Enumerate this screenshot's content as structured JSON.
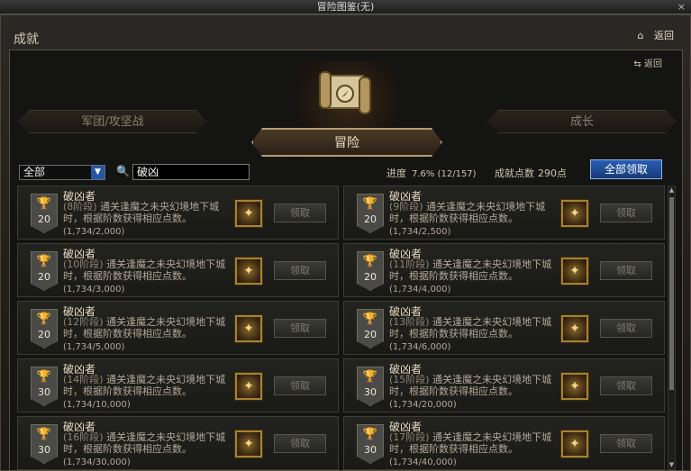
{
  "window": {
    "title": "冒险图鉴(无)"
  },
  "header": {
    "section_title": "成就",
    "back_label": "返回",
    "back_label_small": "返回"
  },
  "tabs": {
    "left": "军团/攻坚战",
    "center": "冒险",
    "right": "成长"
  },
  "filter": {
    "selected": "全部"
  },
  "search": {
    "value": "破凶"
  },
  "stats": {
    "progress_label": "进度",
    "progress_value": "7.6% (12/157)",
    "points_label": "成就点数",
    "points_value": "290点",
    "claim_all_label": "全部领取"
  },
  "cards": [
    {
      "title": "破凶者",
      "stage": "(8阶段)",
      "desc": "通关逢魔之未央幻境地下城时，根据阶数获得相应点数。",
      "progress": "(1,734/2,000)",
      "points": "20",
      "claim": "领取"
    },
    {
      "title": "破凶者",
      "stage": "(9阶段)",
      "desc": "通关逢魔之未央幻境地下城时，根据阶数获得相应点数。",
      "progress": "(1,734/2,500)",
      "points": "20",
      "claim": "领取"
    },
    {
      "title": "破凶者",
      "stage": "(10阶段)",
      "desc": "通关逢魔之未央幻境地下城时，根据阶数获得相应点数。",
      "progress": "(1,734/3,000)",
      "points": "20",
      "claim": "领取"
    },
    {
      "title": "破凶者",
      "stage": "(11阶段)",
      "desc": "通关逢魔之未央幻境地下城时，根据阶数获得相应点数。",
      "progress": "(1,734/4,000)",
      "points": "20",
      "claim": "领取"
    },
    {
      "title": "破凶者",
      "stage": "(12阶段)",
      "desc": "通关逢魔之未央幻境地下城时，根据阶数获得相应点数。",
      "progress": "(1,734/5,000)",
      "points": "20",
      "claim": "领取"
    },
    {
      "title": "破凶者",
      "stage": "(13阶段)",
      "desc": "通关逢魔之未央幻境地下城时，根据阶数获得相应点数。",
      "progress": "(1,734/6,000)",
      "points": "20",
      "claim": "领取"
    },
    {
      "title": "破凶者",
      "stage": "(14阶段)",
      "desc": "通关逢魔之未央幻境地下城时，根据阶数获得相应点数。",
      "progress": "(1,734/10,000)",
      "points": "30",
      "claim": "领取"
    },
    {
      "title": "破凶者",
      "stage": "(15阶段)",
      "desc": "通关逢魔之未央幻境地下城时，根据阶数获得相应点数。",
      "progress": "(1,734/20,000)",
      "points": "30",
      "claim": "领取"
    },
    {
      "title": "破凶者",
      "stage": "(16阶段)",
      "desc": "通关逢魔之未央幻境地下城时，根据阶数获得相应点数。",
      "progress": "(1,734/30,000)",
      "points": "30",
      "claim": "领取"
    },
    {
      "title": "破凶者",
      "stage": "(17阶段)",
      "desc": "通关逢魔之未央幻境地下城时，根据阶数获得相应点数。",
      "progress": "(1,734/40,000)",
      "points": "30",
      "claim": "领取"
    }
  ]
}
